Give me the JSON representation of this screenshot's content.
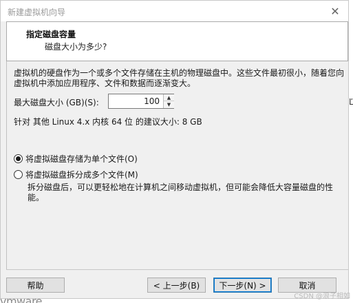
{
  "window": {
    "title": "新建虚拟机向导"
  },
  "header": {
    "title": "指定磁盘容量",
    "subtitle": "磁盘大小为多少?"
  },
  "content": {
    "description": "虚拟机的硬盘作为一个或多个文件存储在主机的物理磁盘中。这些文件最初很小，随着您向虚拟机中添加应用程序、文件和数据而逐渐变大。",
    "size_label": "最大磁盘大小 (GB)(S):",
    "size_value": "100",
    "recommendation": "针对 其他 Linux 4.x 内核 64 位 的建议大小: 8 GB",
    "options": [
      {
        "label": "将虚拟磁盘存储为单个文件(O)",
        "selected": true
      },
      {
        "label": "将虚拟磁盘拆分成多个文件(M)",
        "selected": false
      }
    ],
    "split_note": "拆分磁盘后，可以更轻松地在计算机之间移动虚拟机，但可能会降低大容量磁盘的性能。"
  },
  "footer": {
    "help": "帮助",
    "back": "< 上一步(B)",
    "next": "下一步(N) >",
    "cancel": "取消"
  },
  "brand": "vmware",
  "watermark": "CSDN @浪子相如",
  "edge_char": "Ľ",
  "icons": {
    "close": "close-icon",
    "spin_up": "arrow-up-icon",
    "spin_down": "arrow-down-icon"
  },
  "colors": {
    "accent": "#0078d7",
    "background": "#f0f0f0"
  }
}
